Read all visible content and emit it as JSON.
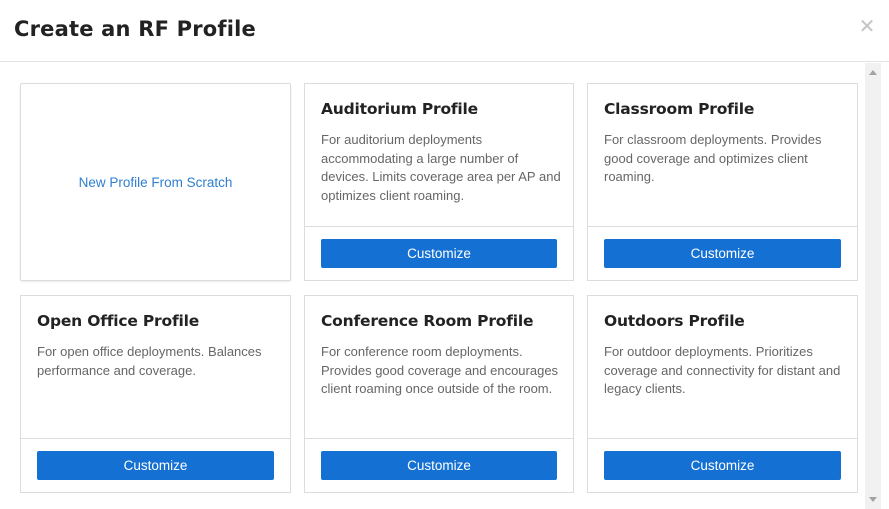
{
  "dialog": {
    "title": "Create an RF Profile",
    "close_icon": "close-icon"
  },
  "scratch": {
    "label": "New Profile From Scratch"
  },
  "profiles": [
    {
      "title": "Auditorium Profile",
      "description": "For auditorium deployments accommodating a large number of devices. Limits coverage area per AP and optimizes client roaming.",
      "button": "Customize"
    },
    {
      "title": "Classroom Profile",
      "description": "For classroom deployments. Provides good coverage and optimizes client roaming.",
      "button": "Customize"
    },
    {
      "title": "Open Office Profile",
      "description": "For open office deployments. Balances performance and coverage.",
      "button": "Customize"
    },
    {
      "title": "Conference Room Profile",
      "description": "For conference room deployments. Provides good coverage and encourages client roaming once outside of the room.",
      "button": "Customize"
    },
    {
      "title": "Outdoors Profile",
      "description": "For outdoor deployments. Prioritizes coverage and connectivity for distant and legacy clients.",
      "button": "Customize"
    }
  ],
  "colors": {
    "accent": "#1470d2",
    "link": "#2f7fce"
  }
}
